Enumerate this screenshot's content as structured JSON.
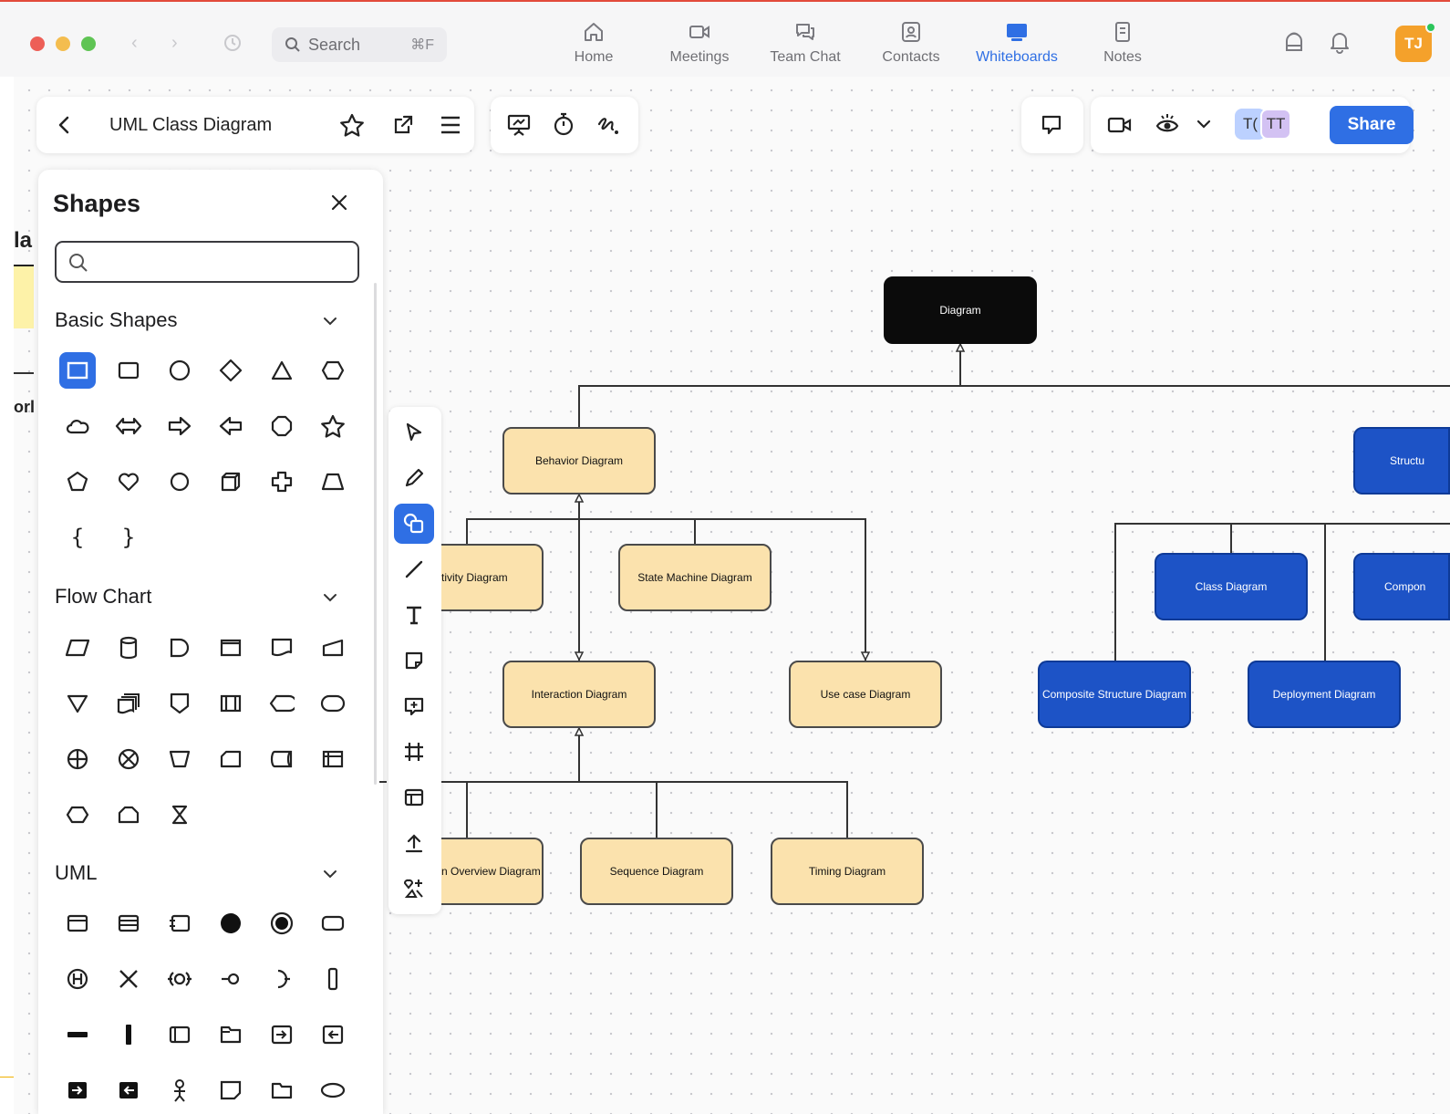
{
  "titlebar": {
    "search_label": "Search",
    "search_shortcut": "⌘F"
  },
  "nav": {
    "items": [
      {
        "label": "Home",
        "icon": "home-icon"
      },
      {
        "label": "Meetings",
        "icon": "video-icon"
      },
      {
        "label": "Team Chat",
        "icon": "chat-icon"
      },
      {
        "label": "Contacts",
        "icon": "contacts-icon"
      },
      {
        "label": "Whiteboards",
        "icon": "whiteboard-icon",
        "active": true
      },
      {
        "label": "Notes",
        "icon": "notes-icon"
      }
    ],
    "avatar_initials": "TJ"
  },
  "board": {
    "title": "UML Class Diagram",
    "share_label": "Share",
    "collaborators": [
      "T(",
      "TT"
    ]
  },
  "shapes_panel": {
    "title": "Shapes",
    "search_placeholder": "",
    "sections": [
      {
        "title": "Basic Shapes"
      },
      {
        "title": "Flow Chart"
      },
      {
        "title": "UML"
      }
    ],
    "braces": [
      "{",
      "}"
    ]
  },
  "diagram": {
    "root": "Diagram",
    "behavior": "Behavior Diagram",
    "structure": "Structu",
    "activity": "tivity Diagram",
    "state_machine": "State Machine Diagram",
    "interaction": "Interaction Diagram",
    "use_case": "Use case Diagram",
    "overview": "n Overview Diagram",
    "sequence": "Sequence Diagram",
    "timing": "Timing Diagram",
    "class": "Class Diagram",
    "component": "Compon",
    "composite": "Composite Structure Diagram",
    "deployment": "Deployment Diagram"
  },
  "colors": {
    "accent": "#2f6fe4",
    "behavior_fill": "#fbe2ad",
    "structure_fill": "#1d53c6",
    "root_fill": "#0b0b0b"
  }
}
